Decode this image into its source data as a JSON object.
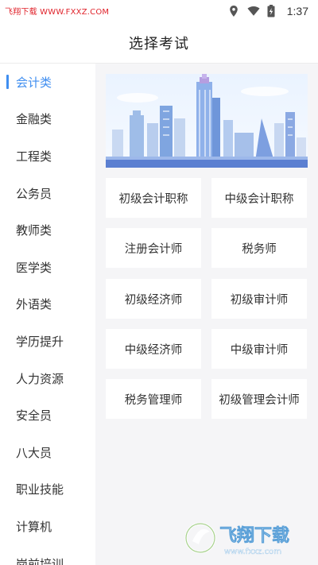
{
  "status": {
    "watermark": "飞翔下载 WWW.FXXZ.COM",
    "time": "1:37",
    "icons": [
      "location-icon",
      "wifi-icon",
      "battery-charging-icon"
    ]
  },
  "header": {
    "title": "选择考试"
  },
  "sidebar": {
    "active_index": 0,
    "accent_color": "#3f8ef0",
    "items": [
      {
        "label": "会计类"
      },
      {
        "label": "金融类"
      },
      {
        "label": "工程类"
      },
      {
        "label": "公务员"
      },
      {
        "label": "教师类"
      },
      {
        "label": "医学类"
      },
      {
        "label": "外语类"
      },
      {
        "label": "学历提升"
      },
      {
        "label": "人力资源"
      },
      {
        "label": "安全员"
      },
      {
        "label": "八大员"
      },
      {
        "label": "职业技能"
      },
      {
        "label": "计算机"
      },
      {
        "label": "岗前培训"
      }
    ]
  },
  "main": {
    "banner_icon": "city-skyline-illustration",
    "exams": [
      {
        "label": "初级会计职称"
      },
      {
        "label": "中级会计职称"
      },
      {
        "label": "注册会计师"
      },
      {
        "label": "税务师"
      },
      {
        "label": "初级经济师"
      },
      {
        "label": "初级审计师"
      },
      {
        "label": "中级经济师"
      },
      {
        "label": "中级审计师"
      },
      {
        "label": "税务管理师"
      },
      {
        "label": "初级管理会计师"
      }
    ]
  },
  "watermark_logo": {
    "brand": "飞翔下载",
    "url": "www.fxxz.com"
  }
}
